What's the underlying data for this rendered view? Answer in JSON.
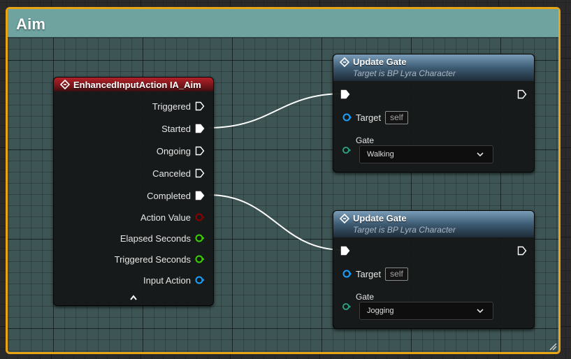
{
  "comment": {
    "title": "Aim",
    "color": "#e7a414",
    "header_color": "#6ea3a0"
  },
  "input_event_node": {
    "title": "EnhancedInputAction IA_Aim",
    "icon": "event-diamond-icon",
    "header_color": "#b22128",
    "outputs": [
      {
        "label": "Triggered",
        "type": "exec"
      },
      {
        "label": "Started",
        "type": "exec"
      },
      {
        "label": "Ongoing",
        "type": "exec"
      },
      {
        "label": "Canceled",
        "type": "exec"
      },
      {
        "label": "Completed",
        "type": "exec"
      },
      {
        "label": "Action Value",
        "type": "bool",
        "color": "#8c0000"
      },
      {
        "label": "Elapsed Seconds",
        "type": "float",
        "color": "#38d400"
      },
      {
        "label": "Triggered Seconds",
        "type": "float",
        "color": "#38d400"
      },
      {
        "label": "Input Action",
        "type": "object",
        "color": "#1aa0ff"
      }
    ],
    "collapse_icon": "chevron-up-icon"
  },
  "update_gate_nodes": [
    {
      "title": "Update Gate",
      "subtitle": "Target is BP Lyra Character",
      "icon": "function-icon",
      "target_label": "Target",
      "target_value": "self",
      "gate_label": "Gate",
      "gate_value": "Walking"
    },
    {
      "title": "Update Gate",
      "subtitle": "Target is BP Lyra Character",
      "icon": "function-icon",
      "target_label": "Target",
      "target_value": "self",
      "gate_label": "Gate",
      "gate_value": "Jogging"
    }
  ],
  "connections": [
    {
      "from": "Started",
      "to": "Update Gate (Walking) exec-in"
    },
    {
      "from": "Completed",
      "to": "Update Gate (Jogging) exec-in"
    }
  ],
  "colors": {
    "exec_pin": "#ffffff",
    "object_pin": "#1aa0ff",
    "gate_pin": "#2ea88a",
    "wire": "#ffffff"
  }
}
